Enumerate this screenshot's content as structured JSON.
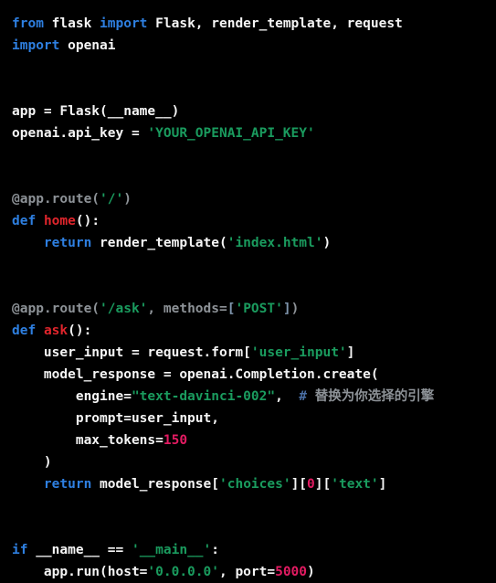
{
  "editor": {
    "language": "python",
    "background": "#000000",
    "colors": {
      "keyword": "#2e7fe0",
      "text": "#f5f5f5",
      "string": "#1a9b5e",
      "number": "#e31b62",
      "function": "#e0252c",
      "comment": "#8d9297"
    }
  },
  "lines": [
    {
      "n": 1,
      "tokens": [
        {
          "t": "from",
          "c": "t-kw"
        },
        {
          "t": " flask ",
          "c": "t-txt"
        },
        {
          "t": "import",
          "c": "t-kw"
        },
        {
          "t": " Flask, render_template, request",
          "c": "t-txt"
        }
      ]
    },
    {
      "n": 2,
      "tokens": [
        {
          "t": "import",
          "c": "t-kw"
        },
        {
          "t": " openai",
          "c": "t-txt"
        }
      ]
    },
    {
      "n": 3,
      "tokens": []
    },
    {
      "n": 4,
      "tokens": []
    },
    {
      "n": 5,
      "tokens": [
        {
          "t": "app = Flask(__name__)",
          "c": "t-txt"
        }
      ]
    },
    {
      "n": 6,
      "tokens": [
        {
          "t": "openai.api_key = ",
          "c": "t-txt"
        },
        {
          "t": "'YOUR_OPENAI_API_KEY'",
          "c": "t-str"
        }
      ]
    },
    {
      "n": 7,
      "tokens": []
    },
    {
      "n": 8,
      "tokens": []
    },
    {
      "n": 9,
      "tokens": [
        {
          "t": "@app.route(",
          "c": "t-dec"
        },
        {
          "t": "'/'",
          "c": "t-str"
        },
        {
          "t": ")",
          "c": "t-dec"
        }
      ]
    },
    {
      "n": 10,
      "tokens": [
        {
          "t": "def",
          "c": "t-kw"
        },
        {
          "t": " ",
          "c": "t-txt"
        },
        {
          "t": "home",
          "c": "t-fn"
        },
        {
          "t": "():",
          "c": "t-txt"
        }
      ]
    },
    {
      "n": 11,
      "tokens": [
        {
          "t": "    ",
          "c": "t-txt"
        },
        {
          "t": "return",
          "c": "t-kw"
        },
        {
          "t": " render_template(",
          "c": "t-txt"
        },
        {
          "t": "'index.html'",
          "c": "t-str"
        },
        {
          "t": ")",
          "c": "t-txt"
        }
      ]
    },
    {
      "n": 12,
      "tokens": []
    },
    {
      "n": 13,
      "tokens": []
    },
    {
      "n": 14,
      "tokens": [
        {
          "t": "@app.route(",
          "c": "t-dec"
        },
        {
          "t": "'/ask'",
          "c": "t-str"
        },
        {
          "t": ", methods=",
          "c": "t-dec"
        },
        {
          "t": "[",
          "c": "t-decbrk"
        },
        {
          "t": "'POST'",
          "c": "t-str"
        },
        {
          "t": "]",
          "c": "t-decbrk"
        },
        {
          "t": ")",
          "c": "t-dec"
        }
      ]
    },
    {
      "n": 15,
      "tokens": [
        {
          "t": "def",
          "c": "t-kw"
        },
        {
          "t": " ",
          "c": "t-txt"
        },
        {
          "t": "ask",
          "c": "t-fn"
        },
        {
          "t": "():",
          "c": "t-txt"
        }
      ]
    },
    {
      "n": 16,
      "tokens": [
        {
          "t": "    user_input = request.form",
          "c": "t-txt"
        },
        {
          "t": "[",
          "c": "t-brk"
        },
        {
          "t": "'user_input'",
          "c": "t-str"
        },
        {
          "t": "]",
          "c": "t-brk"
        }
      ]
    },
    {
      "n": 17,
      "tokens": [
        {
          "t": "    model_response = openai.Completion.create(",
          "c": "t-txt"
        }
      ]
    },
    {
      "n": 18,
      "tokens": [
        {
          "t": "        engine=",
          "c": "t-txt"
        },
        {
          "t": "\"text-davinci-002\"",
          "c": "t-str"
        },
        {
          "t": ",  ",
          "c": "t-txt"
        },
        {
          "t": "#",
          "c": "t-hash"
        },
        {
          "t": " 替换为你选择的引擎",
          "c": "t-com"
        }
      ]
    },
    {
      "n": 19,
      "tokens": [
        {
          "t": "        prompt=user_input,",
          "c": "t-txt"
        }
      ]
    },
    {
      "n": 20,
      "tokens": [
        {
          "t": "        max_tokens=",
          "c": "t-txt"
        },
        {
          "t": "150",
          "c": "t-num"
        }
      ]
    },
    {
      "n": 21,
      "tokens": [
        {
          "t": "    )",
          "c": "t-txt"
        }
      ]
    },
    {
      "n": 22,
      "tokens": [
        {
          "t": "    ",
          "c": "t-txt"
        },
        {
          "t": "return",
          "c": "t-kw"
        },
        {
          "t": " model_response",
          "c": "t-txt"
        },
        {
          "t": "[",
          "c": "t-brk"
        },
        {
          "t": "'choices'",
          "c": "t-str"
        },
        {
          "t": "][",
          "c": "t-brk"
        },
        {
          "t": "0",
          "c": "t-num"
        },
        {
          "t": "][",
          "c": "t-brk"
        },
        {
          "t": "'text'",
          "c": "t-str"
        },
        {
          "t": "]",
          "c": "t-brk"
        }
      ]
    },
    {
      "n": 23,
      "tokens": []
    },
    {
      "n": 24,
      "tokens": []
    },
    {
      "n": 25,
      "tokens": [
        {
          "t": "if",
          "c": "t-kw"
        },
        {
          "t": " __name__ == ",
          "c": "t-txt"
        },
        {
          "t": "'__main__'",
          "c": "t-str"
        },
        {
          "t": ":",
          "c": "t-txt"
        }
      ]
    },
    {
      "n": 26,
      "tokens": [
        {
          "t": "    app.run(host=",
          "c": "t-txt"
        },
        {
          "t": "'0.0.0.0'",
          "c": "t-str"
        },
        {
          "t": ", port=",
          "c": "t-txt"
        },
        {
          "t": "5000",
          "c": "t-num"
        },
        {
          "t": ")",
          "c": "t-txt"
        }
      ]
    }
  ]
}
